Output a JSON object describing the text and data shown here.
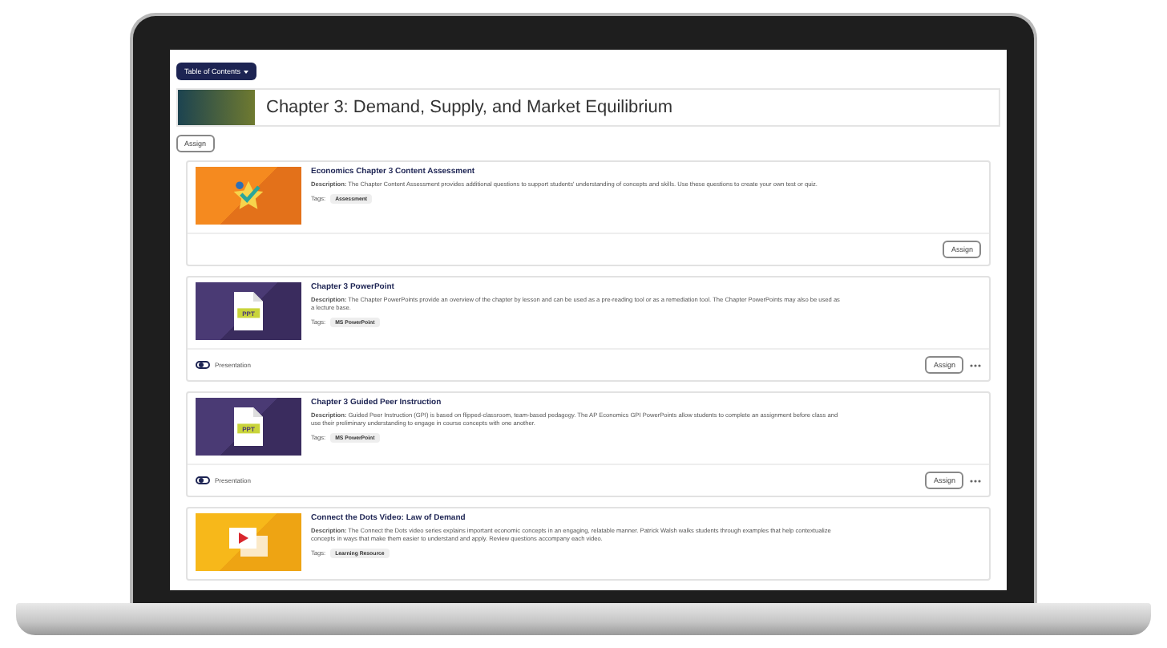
{
  "toc_button": {
    "label": "Table of Contents"
  },
  "chapter": {
    "title": "Chapter 3: Demand, Supply, and Market Equilibrium"
  },
  "assign_all": {
    "label": "Assign"
  },
  "items": [
    {
      "kind": "assessment",
      "title": "Economics Chapter 3 Content Assessment",
      "description": "**Description:** The Chapter Content Assessment provides additional questions to support students' understanding of concepts and skills. Use these questions to create your own test or quiz.",
      "tags_label": "Tags:",
      "tag": "Assessment",
      "assign": "Assign"
    },
    {
      "kind": "powerpoint",
      "thumb_label": "PPT",
      "title": "Chapter 3 PowerPoint",
      "description": "**Description:** The Chapter PowerPoints provide an overview of the chapter by lesson and can be used as a pre-reading tool or as a remediation tool. The Chapter PowerPoints may also be used as a lecture base.",
      "tags_label": "Tags:",
      "tag": "MS PowerPoint",
      "presentation": {
        "label": "Presentation",
        "on": false
      },
      "assign": "Assign"
    },
    {
      "kind": "powerpoint",
      "thumb_label": "PPT",
      "title": "Chapter 3 Guided Peer Instruction",
      "description": "**Description:** Guided Peer Instruction (GPI) is based on flipped-classroom, team-based pedagogy. The AP Economics GPI PowerPoints allow students to complete an assignment before class and use their preliminary understanding to engage in course concepts with one another.",
      "tags_label": "Tags:",
      "tag": "MS PowerPoint",
      "presentation": {
        "label": "Presentation",
        "on": false
      },
      "assign": "Assign"
    },
    {
      "kind": "video",
      "title": "Connect the Dots Video: Law of Demand",
      "description": "**Description:** The Connect the Dots video series explains important economic concepts in an engaging, relatable manner. Patrick Walsh walks students through examples that help contextualize concepts in ways that make them easier to understand and apply. Review questions accompany each video.",
      "tags_label": "Tags:",
      "tag": "Learning Resource"
    }
  ]
}
